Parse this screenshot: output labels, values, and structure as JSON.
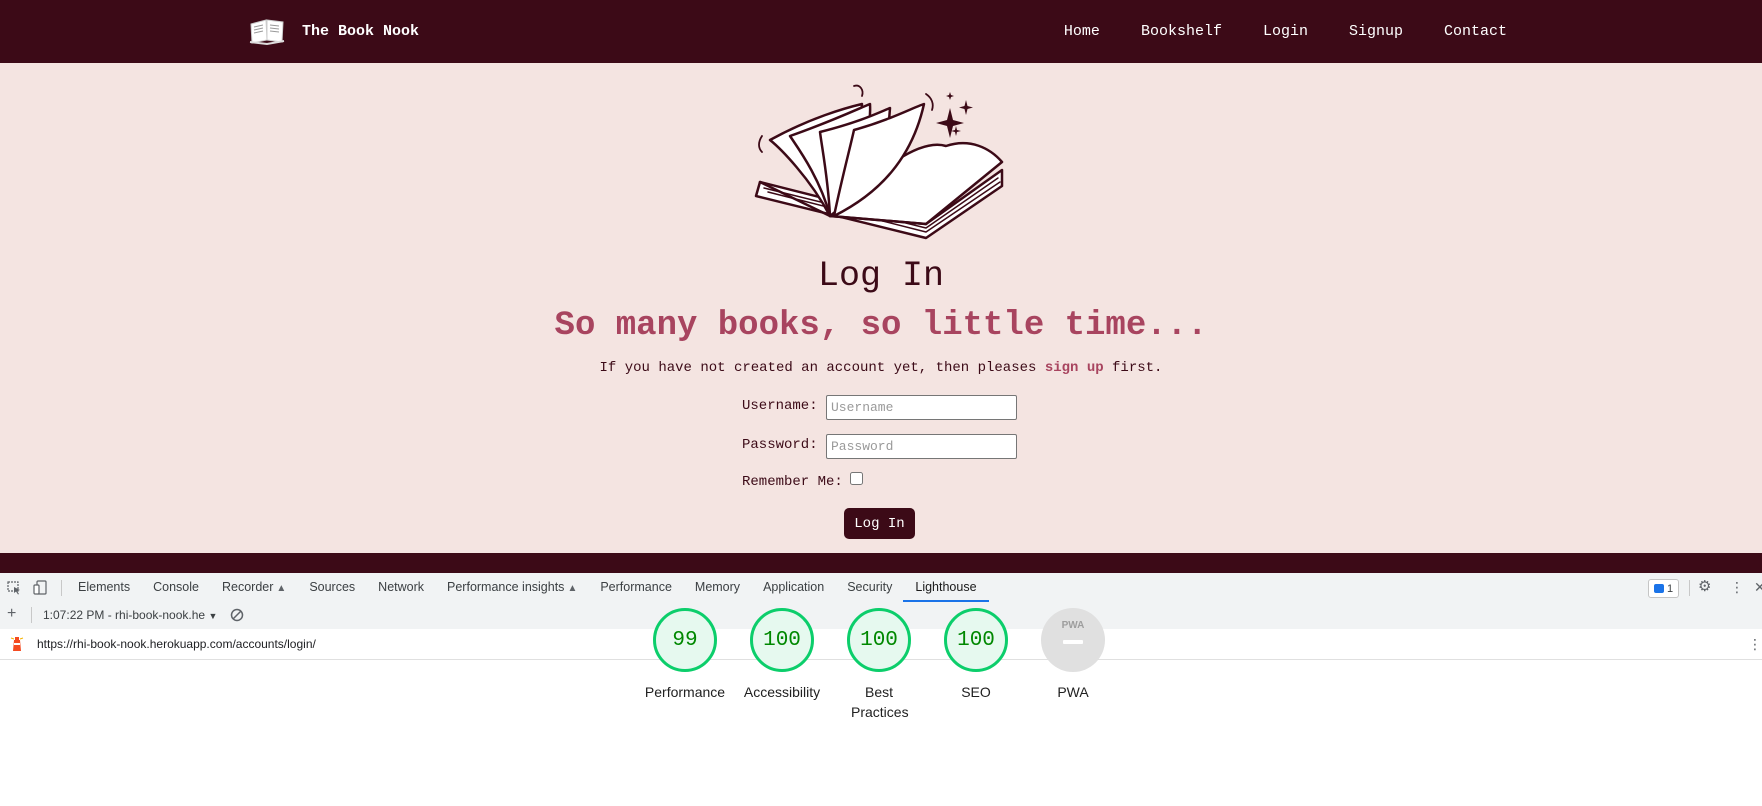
{
  "site": {
    "brand": "The Book Nook",
    "nav": [
      "Home",
      "Bookshelf",
      "Login",
      "Signup",
      "Contact"
    ]
  },
  "page": {
    "title": "Log In",
    "tagline": "So many books, so little time...",
    "intro_prefix": "If you have not created an account yet, then pleases",
    "intro_link": "sign up",
    "intro_suffix": "first."
  },
  "form": {
    "username_label": "Username:",
    "username_placeholder": "Username",
    "password_label": "Password:",
    "password_placeholder": "Password",
    "remember_label": "Remember Me:",
    "submit_label": "Log In"
  },
  "devtools": {
    "tabs": [
      "Elements",
      "Console",
      "Recorder",
      "Sources",
      "Network",
      "Performance insights",
      "Performance",
      "Memory",
      "Application",
      "Security",
      "Lighthouse"
    ],
    "active_tab": "Lighthouse",
    "issues_count": "1",
    "report_label": "1:07:22 PM - rhi-book-nook.he",
    "url": "https://rhi-book-nook.herokuapp.com/accounts/login/",
    "scores": [
      {
        "label": "Performance",
        "score": "99"
      },
      {
        "label": "Accessibility",
        "score": "100"
      },
      {
        "label": "Best Practices",
        "score": "100"
      },
      {
        "label": "SEO",
        "score": "100"
      }
    ],
    "pwa": {
      "label": "PWA",
      "badge": "PWA"
    }
  },
  "colors": {
    "nav_bg": "#3c0a17",
    "page_bg": "#f4e4e1",
    "accent": "#a8445f",
    "score_pass": "#0cce6b"
  }
}
